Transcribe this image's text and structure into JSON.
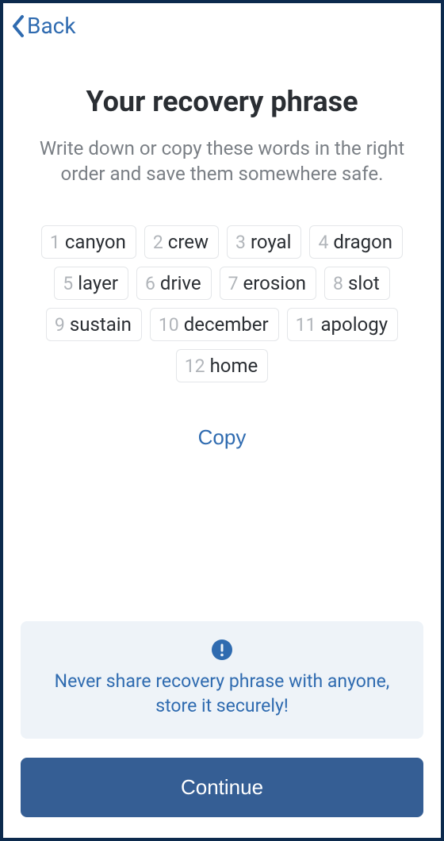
{
  "nav": {
    "back_label": "Back"
  },
  "title": "Your recovery phrase",
  "subtitle": "Write down or copy these words in the right order and save them somewhere safe.",
  "phrase": [
    {
      "n": "1",
      "w": "canyon"
    },
    {
      "n": "2",
      "w": "crew"
    },
    {
      "n": "3",
      "w": "royal"
    },
    {
      "n": "4",
      "w": "dragon"
    },
    {
      "n": "5",
      "w": "layer"
    },
    {
      "n": "6",
      "w": "drive"
    },
    {
      "n": "7",
      "w": "erosion"
    },
    {
      "n": "8",
      "w": "slot"
    },
    {
      "n": "9",
      "w": "sustain"
    },
    {
      "n": "10",
      "w": "december"
    },
    {
      "n": "11",
      "w": "apology"
    },
    {
      "n": "12",
      "w": "home"
    }
  ],
  "copy_label": "Copy",
  "warning_text": "Never share recovery phrase with anyone, store it securely!",
  "continue_label": "Continue",
  "colors": {
    "accent": "#2f6bb0",
    "primary_button": "#355e94",
    "border": "#0c2a4d",
    "chip_border": "#e4e6e9",
    "muted_text": "#7a7f85",
    "warning_bg": "#eef3f8"
  }
}
